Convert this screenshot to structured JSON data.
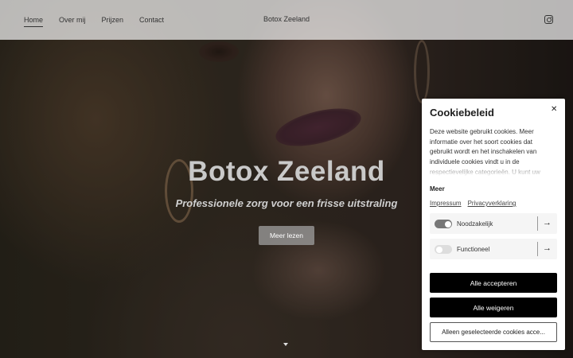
{
  "header": {
    "nav": [
      "Home",
      "Over mij",
      "Prijzen",
      "Contact"
    ],
    "brand": "Botox Zeeland",
    "social_icon": "instagram-icon"
  },
  "hero": {
    "title": "Botox Zeeland",
    "subtitle": "Professionele zorg voor een frisse uitstraling",
    "button_label": "Meer lezen",
    "scroll_icon": "chevron-down-icon"
  },
  "cookie_panel": {
    "title": "Cookiebeleid",
    "close_icon": "close-icon",
    "description": "Deze website gebruikt cookies. Meer informatie over het soort cookies dat gebruikt wordt en het inschakelen van individuele cookies vindt u in de respectievelijke categorieën. U kunt uw",
    "more_label": "Meer",
    "links": [
      "Impressum",
      "Privacyverklaring"
    ],
    "options": [
      {
        "label": "Noodzakelijk",
        "enabled": true
      },
      {
        "label": "Functioneel",
        "enabled": false
      }
    ],
    "accept_all": "Alle accepteren",
    "reject_all": "Alle weigeren",
    "accept_selected": "Alleen geselecteerde cookies acce..."
  }
}
